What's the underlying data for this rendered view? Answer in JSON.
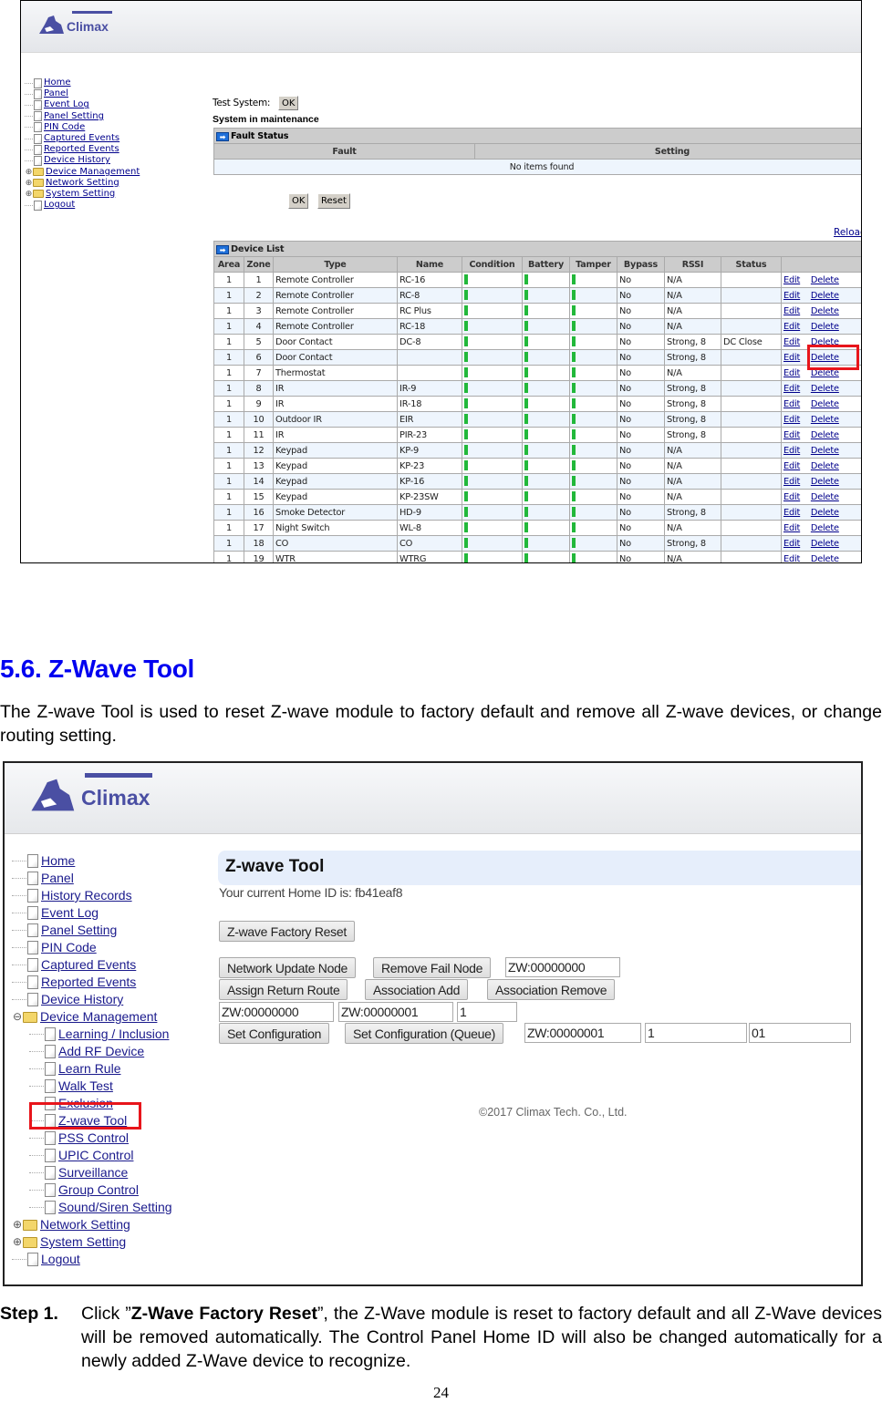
{
  "screenshot1": {
    "logo_text": "Climax",
    "sidebar": [
      {
        "label": "Home",
        "type": "page"
      },
      {
        "label": "Panel",
        "type": "page"
      },
      {
        "label": "Event Log",
        "type": "page"
      },
      {
        "label": "Panel Setting",
        "type": "page"
      },
      {
        "label": "PIN Code",
        "type": "page"
      },
      {
        "label": "Captured Events",
        "type": "page"
      },
      {
        "label": "Reported Events",
        "type": "page"
      },
      {
        "label": "Device History",
        "type": "page"
      },
      {
        "label": "Device Management",
        "type": "folder"
      },
      {
        "label": "Network Setting",
        "type": "folder"
      },
      {
        "label": "System Setting",
        "type": "folder"
      },
      {
        "label": "Logout",
        "type": "page"
      }
    ],
    "test_system_label": "Test System:",
    "test_system_button": "OK",
    "status_text": "System in maintenance",
    "fault_status": {
      "title": "Fault Status",
      "columns": [
        "Fault",
        "Setting"
      ],
      "empty_text": "No items found"
    },
    "ok_button": "OK",
    "reset_button": "Reset",
    "reload_link": "Reload",
    "device_list": {
      "title": "Device List",
      "columns": [
        "Area",
        "Zone",
        "Type",
        "Name",
        "Condition",
        "Battery",
        "Tamper",
        "Bypass",
        "RSSI",
        "Status",
        ""
      ],
      "edit_label": "Edit",
      "delete_label": "Delete",
      "highlighted_row_zone": "6",
      "rows": [
        {
          "area": "1",
          "zone": "1",
          "type": "Remote Controller",
          "name": "RC-16",
          "bypass": "No",
          "rssi": "N/A",
          "status": ""
        },
        {
          "area": "1",
          "zone": "2",
          "type": "Remote Controller",
          "name": "RC-8",
          "bypass": "No",
          "rssi": "N/A",
          "status": ""
        },
        {
          "area": "1",
          "zone": "3",
          "type": "Remote Controller",
          "name": "RC Plus",
          "bypass": "No",
          "rssi": "N/A",
          "status": ""
        },
        {
          "area": "1",
          "zone": "4",
          "type": "Remote Controller",
          "name": "RC-18",
          "bypass": "No",
          "rssi": "N/A",
          "status": ""
        },
        {
          "area": "1",
          "zone": "5",
          "type": "Door Contact",
          "name": "DC-8",
          "bypass": "No",
          "rssi": "Strong, 8",
          "status": "DC Close"
        },
        {
          "area": "1",
          "zone": "6",
          "type": "Door Contact",
          "name": "",
          "bypass": "No",
          "rssi": "Strong, 8",
          "status": ""
        },
        {
          "area": "1",
          "zone": "7",
          "type": "Thermostat",
          "name": "",
          "bypass": "No",
          "rssi": "N/A",
          "status": ""
        },
        {
          "area": "1",
          "zone": "8",
          "type": "IR",
          "name": "IR-9",
          "bypass": "No",
          "rssi": "Strong, 8",
          "status": ""
        },
        {
          "area": "1",
          "zone": "9",
          "type": "IR",
          "name": "IR-18",
          "bypass": "No",
          "rssi": "Strong, 8",
          "status": ""
        },
        {
          "area": "1",
          "zone": "10",
          "type": "Outdoor IR",
          "name": "EIR",
          "bypass": "No",
          "rssi": "Strong, 8",
          "status": ""
        },
        {
          "area": "1",
          "zone": "11",
          "type": "IR",
          "name": "PIR-23",
          "bypass": "No",
          "rssi": "Strong, 8",
          "status": ""
        },
        {
          "area": "1",
          "zone": "12",
          "type": "Keypad",
          "name": "KP-9",
          "bypass": "No",
          "rssi": "N/A",
          "status": ""
        },
        {
          "area": "1",
          "zone": "13",
          "type": "Keypad",
          "name": "KP-23",
          "bypass": "No",
          "rssi": "N/A",
          "status": ""
        },
        {
          "area": "1",
          "zone": "14",
          "type": "Keypad",
          "name": "KP-16",
          "bypass": "No",
          "rssi": "N/A",
          "status": ""
        },
        {
          "area": "1",
          "zone": "15",
          "type": "Keypad",
          "name": "KP-23SW",
          "bypass": "No",
          "rssi": "N/A",
          "status": ""
        },
        {
          "area": "1",
          "zone": "16",
          "type": "Smoke Detector",
          "name": "HD-9",
          "bypass": "No",
          "rssi": "Strong, 8",
          "status": ""
        },
        {
          "area": "1",
          "zone": "17",
          "type": "Night Switch",
          "name": "WL-8",
          "bypass": "No",
          "rssi": "N/A",
          "status": ""
        },
        {
          "area": "1",
          "zone": "18",
          "type": "CO",
          "name": "CO",
          "bypass": "No",
          "rssi": "Strong, 8",
          "status": ""
        },
        {
          "area": "1",
          "zone": "19",
          "type": "WTR",
          "name": "WTRG",
          "bypass": "No",
          "rssi": "N/A",
          "status": ""
        }
      ]
    }
  },
  "section": {
    "title": "5.6. Z-Wave Tool",
    "body": "The Z-wave Tool is used to reset Z-wave module to factory default and remove all Z-wave devices, or change routing setting."
  },
  "screenshot2": {
    "logo_text": "Climax",
    "sidebar": [
      {
        "label": "Home",
        "type": "page",
        "level": 0
      },
      {
        "label": "Panel",
        "type": "page",
        "level": 0
      },
      {
        "label": "History Records",
        "type": "page",
        "level": 0
      },
      {
        "label": "Event Log",
        "type": "page",
        "level": 0
      },
      {
        "label": "Panel Setting",
        "type": "page",
        "level": 0
      },
      {
        "label": "PIN Code",
        "type": "page",
        "level": 0
      },
      {
        "label": "Captured Events",
        "type": "page",
        "level": 0
      },
      {
        "label": "Reported Events",
        "type": "page",
        "level": 0
      },
      {
        "label": "Device History",
        "type": "page",
        "level": 0
      },
      {
        "label": "Device Management",
        "type": "folder-open",
        "level": 0
      },
      {
        "label": "Learning / Inclusion",
        "type": "page",
        "level": 1
      },
      {
        "label": "Add RF Device",
        "type": "page",
        "level": 1
      },
      {
        "label": "Learn Rule",
        "type": "page",
        "level": 1
      },
      {
        "label": "Walk Test",
        "type": "page",
        "level": 1
      },
      {
        "label": "Exclusion",
        "type": "page",
        "level": 1
      },
      {
        "label": "Z-wave Tool",
        "type": "page",
        "level": 1,
        "highlighted": true
      },
      {
        "label": "PSS Control",
        "type": "page",
        "level": 1
      },
      {
        "label": "UPIC Control",
        "type": "page",
        "level": 1
      },
      {
        "label": "Surveillance",
        "type": "page",
        "level": 1
      },
      {
        "label": "Group Control",
        "type": "page",
        "level": 1
      },
      {
        "label": "Sound/Siren Setting",
        "type": "page",
        "level": 1
      },
      {
        "label": "Network Setting",
        "type": "folder",
        "level": 0
      },
      {
        "label": "System Setting",
        "type": "folder",
        "level": 0
      },
      {
        "label": "Logout",
        "type": "page",
        "level": 0
      }
    ],
    "page_title": "Z-wave Tool",
    "home_id_text": "Your current Home ID is: fb41eaf8",
    "buttons": {
      "factory_reset": "Z-wave Factory Reset",
      "network_update_node": "Network Update Node",
      "remove_fail_node": "Remove Fail Node",
      "assign_return_route": "Assign Return Route",
      "association_add": "Association Add",
      "association_remove": "Association Remove",
      "set_configuration": "Set Configuration",
      "set_configuration_queue": "Set Configuration (Queue)"
    },
    "inputs": {
      "remove_fail_node_id": "ZW:00000000",
      "route_src": "ZW:00000000",
      "route_dst": "ZW:00000001",
      "route_group": "1",
      "config_node": "ZW:00000001",
      "config_param": "1",
      "config_value": "01"
    },
    "copyright": "©2017 Climax Tech. Co., Ltd."
  },
  "step1": {
    "label": "Step 1.",
    "prefix": "Click ”",
    "bold": "Z-Wave Factory Reset",
    "suffix": "”, the Z-Wave module is reset to factory default and all Z-Wave devices will be removed automatically. The Control Panel Home ID will also be changed automatically for a newly added Z-Wave device to recognize."
  },
  "page_number": "24",
  "colors": {
    "heading_blue": "#0000f0",
    "highlight_red": "#e8151b",
    "ok_green": "#22b83a",
    "link_blue": "#00008b",
    "brand_purple": "#4a4fa3"
  }
}
